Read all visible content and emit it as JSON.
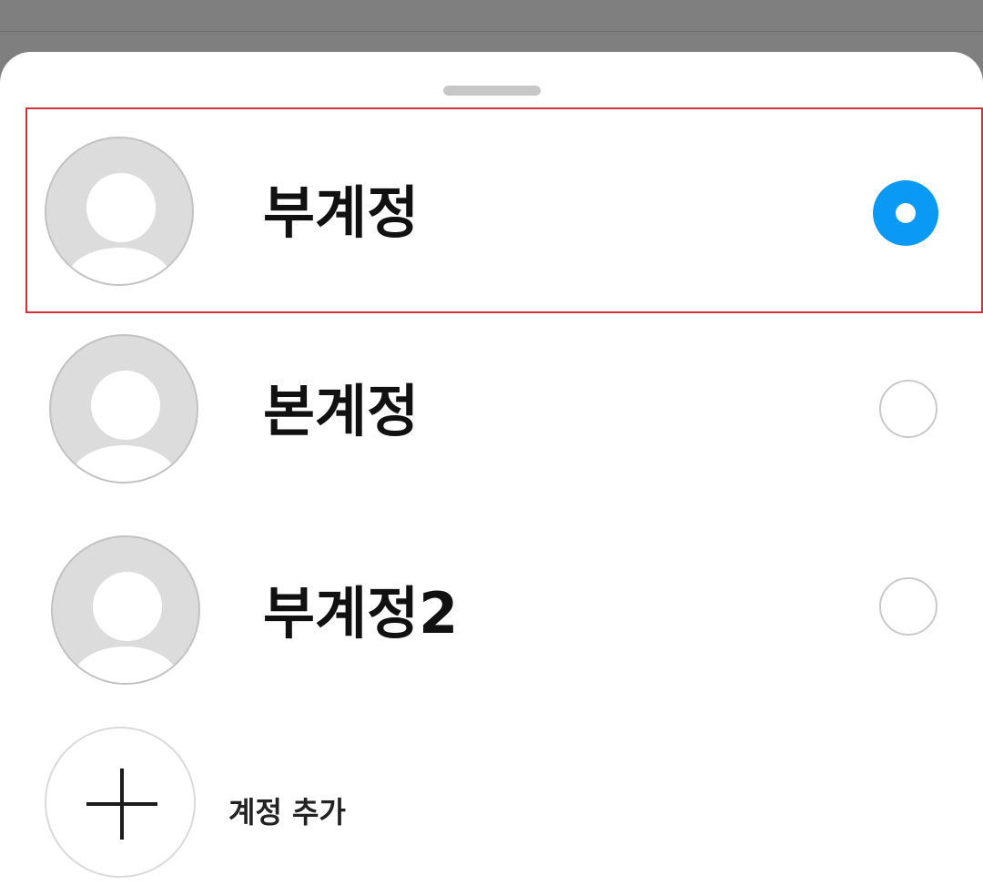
{
  "sheet": {
    "accounts": [
      {
        "name": "부계정",
        "selected": true
      },
      {
        "name": "본계정",
        "selected": false
      },
      {
        "name": "부계정2",
        "selected": false
      }
    ],
    "add_account_label": "계정 추가"
  },
  "icons": {
    "avatar": "default-profile-icon",
    "add": "plus-icon",
    "radio_on": "radio-selected-icon",
    "radio_off": "radio-unselected-icon"
  },
  "colors": {
    "scrim": "#7f7f7f",
    "sheet_bg": "#ffffff",
    "radio_selected": "#0a9af5",
    "highlight_border": "#d6303b"
  }
}
